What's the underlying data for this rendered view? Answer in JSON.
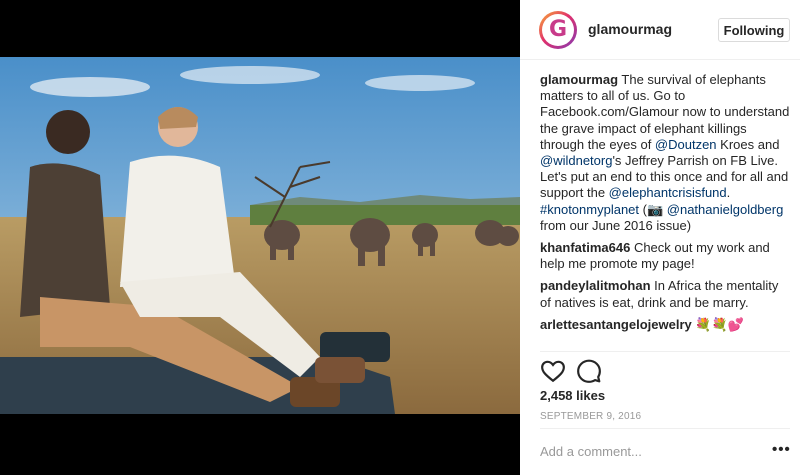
{
  "post": {
    "username": "glamourmag",
    "avatar_letter": "G",
    "follow_label": "Following",
    "caption": {
      "username": "glamourmag",
      "parts": [
        {
          "text": " The survival of elephants matters to all of us. Go to Facebook.com/Glamour now to understand the grave impact of elephant killings through the eyes of ",
          "link": false
        },
        {
          "text": "@Doutzen",
          "link": true
        },
        {
          "text": " Kroes and ",
          "link": false
        },
        {
          "text": "@wildnetorg",
          "link": true
        },
        {
          "text": "'s Jeffrey Parrish on FB Live. Let's put an end to this once and for all and support the ",
          "link": false
        },
        {
          "text": "@elephantcrisisfund",
          "link": true
        },
        {
          "text": ". ",
          "link": false
        },
        {
          "text": "#knotonmyplanet",
          "link": true
        },
        {
          "text": " (📷 ",
          "link": false
        },
        {
          "text": "@nathanielgoldberg",
          "link": true
        },
        {
          "text": " from our June 2016 issue)",
          "link": false
        }
      ]
    },
    "comments": [
      {
        "username": "khanfatima646",
        "text": " Check out my work and help me promote my page!"
      },
      {
        "username": "pandeylalitmohan",
        "text": " In Africa the mentality of natives is eat, drink and be marry."
      },
      {
        "username": "arlettesantangelojewelry",
        "text": " 💐💐💕"
      },
      {
        "username": "",
        "text": "                   👏👏👏👏👏👏"
      }
    ],
    "likes": "2,458 likes",
    "date": "SEPTEMBER 9, 2016",
    "add_comment_placeholder": "Add a comment...",
    "more_label": "•••"
  },
  "icons": [
    "heart-icon",
    "comment-icon"
  ],
  "colors": {
    "link": "#003569",
    "text": "#262626",
    "muted": "#999999",
    "divider": "#efefef"
  }
}
